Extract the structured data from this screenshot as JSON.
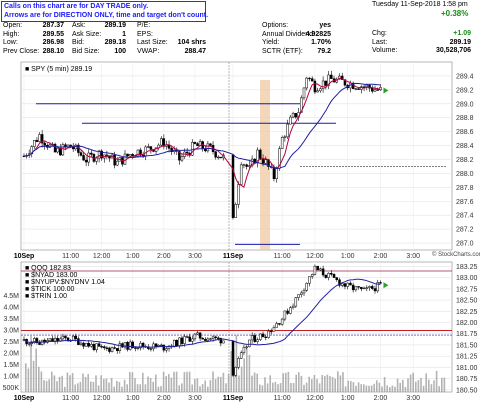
{
  "notice": {
    "line1": "Calls on this chart are for DAY TRADE only.",
    "line2": "Arrows are for DIRECTION ONLY, time and target don't count."
  },
  "branding": {
    "site": "© StockCharts.com"
  },
  "header": {
    "datetime": "Tuesday  11-Sep-2018  1:58 pm",
    "quote": [
      {
        "k": "Open:",
        "v": "287.37"
      },
      {
        "k": "High:",
        "v": "289.55"
      },
      {
        "k": "Low:",
        "v": "286.98"
      },
      {
        "k": "Prev Close:",
        "v": "288.10"
      }
    ],
    "bidask": [
      {
        "k": "Ask:",
        "v": "289.19"
      },
      {
        "k": "Ask Size:",
        "v": "1"
      },
      {
        "k": "Bid:",
        "v": "289.18"
      },
      {
        "k": "Bid Size:",
        "v": "100"
      }
    ],
    "mid": [
      {
        "k": "P/E:",
        "v": ""
      },
      {
        "k": "EPS:",
        "v": ""
      },
      {
        "k": "Last Size:",
        "v": "104 shrs"
      },
      {
        "k": "VWAP:",
        "v": "288.47"
      }
    ],
    "fund": [
      {
        "k": "Options:",
        "v": "yes"
      },
      {
        "k": "Annual Dividend:",
        "v": "4.92825"
      },
      {
        "k": "Yield:",
        "v": "1.70%"
      },
      {
        "k": "SCTR (ETF):",
        "v": "79.2"
      }
    ],
    "change_pct": "+0.38%",
    "change": [
      {
        "k": "Chg:",
        "v": "+1.09"
      },
      {
        "k": "Last:",
        "v": "289.19"
      },
      {
        "k": "Volume:",
        "v": "30,528,706"
      }
    ]
  },
  "colors": {
    "price": "#000000",
    "ma_fast": "#b40046",
    "ma_slow": "#2020a0",
    "hline": "#1a1aaa",
    "zone": "#f0c8a0",
    "red_line": "#c00000",
    "green_arrow": "#2ca02c"
  },
  "chart_data": [
    {
      "type": "line",
      "title": "SPY (5 min) 289.19",
      "ylim": [
        286.9,
        289.6
      ],
      "y_ticks": [
        287.0,
        287.2,
        287.4,
        287.6,
        287.8,
        288.0,
        288.2,
        288.4,
        288.6,
        288.8,
        289.0,
        289.2,
        289.4
      ],
      "y_tick_labels": [
        "287.0",
        "287.2",
        "287.4",
        "287.6",
        "287.8",
        "288.0",
        "288.2",
        "288.4",
        "288.6",
        "288.8",
        "289.0",
        "289.2",
        "289.4"
      ],
      "x_tick_labels": [
        "10Sep",
        "11:00",
        "12:00",
        "1:00",
        "2:00",
        "3:00",
        "11Sep",
        "11:00",
        "12:00",
        "1:00",
        "2:00",
        "3:00"
      ],
      "x_tick_hours": [
        9.5,
        11,
        12,
        13,
        14,
        15,
        33.5,
        35,
        36,
        37,
        38,
        39
      ],
      "horizontal_lines": [
        289.0,
        288.72,
        288.1
      ],
      "series": [
        {
          "name": "SPY",
          "x": [
            9.5,
            10,
            10.5,
            11,
            11.5,
            12,
            12.5,
            13,
            13.5,
            14,
            14.5,
            15,
            15.5,
            16,
            33.5,
            33.75,
            34,
            34.25,
            34.5,
            34.75,
            35,
            35.25,
            35.5,
            35.75,
            36,
            36.5,
            37,
            37.5,
            38
          ],
          "y": [
            288.25,
            288.55,
            288.3,
            288.4,
            288.2,
            288.3,
            288.15,
            288.3,
            288.35,
            288.45,
            288.2,
            288.4,
            288.35,
            288.2,
            287.3,
            288.2,
            288.05,
            288.3,
            288.15,
            287.95,
            288.5,
            288.75,
            288.9,
            289.4,
            289.25,
            289.35,
            289.3,
            289.25,
            289.19
          ]
        }
      ]
    },
    {
      "type": "line",
      "title": "QQQ 182.83",
      "ylim": [
        180.45,
        183.35
      ],
      "y_ticks": [
        180.5,
        180.75,
        181.0,
        181.25,
        181.5,
        181.75,
        182.0,
        182.25,
        182.5,
        182.75,
        183.0,
        183.25
      ],
      "y_tick_labels": [
        "180.50",
        "180.75",
        "181.00",
        "181.25",
        "181.50",
        "181.75",
        "182.00",
        "182.25",
        "182.50",
        "182.75",
        "183.00",
        "183.25"
      ],
      "volume_labels": [
        "4.5M",
        "4.0M",
        "3.5M",
        "3.0M",
        "2.5M",
        "2.0M",
        "1.5M",
        "1.0M",
        "500K"
      ],
      "x_tick_labels": [
        "10Sep",
        "11:00",
        "12:00",
        "1:00",
        "2:00",
        "3:00",
        "11Sep",
        "11:00",
        "12:00",
        "1:00",
        "2:00",
        "3:00"
      ],
      "horizontal_lines": [
        183.15,
        181.82,
        181.72
      ],
      "series": [
        {
          "name": "QQQ",
          "x": [
            9.5,
            10,
            11,
            12,
            13,
            14,
            15,
            16,
            33.5,
            34,
            34.5,
            35,
            35.5,
            36,
            36.5,
            37,
            37.5,
            38
          ],
          "y": [
            181.6,
            181.55,
            181.65,
            181.4,
            181.5,
            181.45,
            181.7,
            181.6,
            180.9,
            181.6,
            181.75,
            182.1,
            182.6,
            183.2,
            183.0,
            182.8,
            182.7,
            182.83
          ]
        }
      ],
      "legend": [
        "QQQ 182.83",
        "$NYAD 183.00",
        "$NYUPV:$NYDNV 1.04",
        "$TICK 100.00",
        "$TRIN 1.00"
      ]
    }
  ]
}
